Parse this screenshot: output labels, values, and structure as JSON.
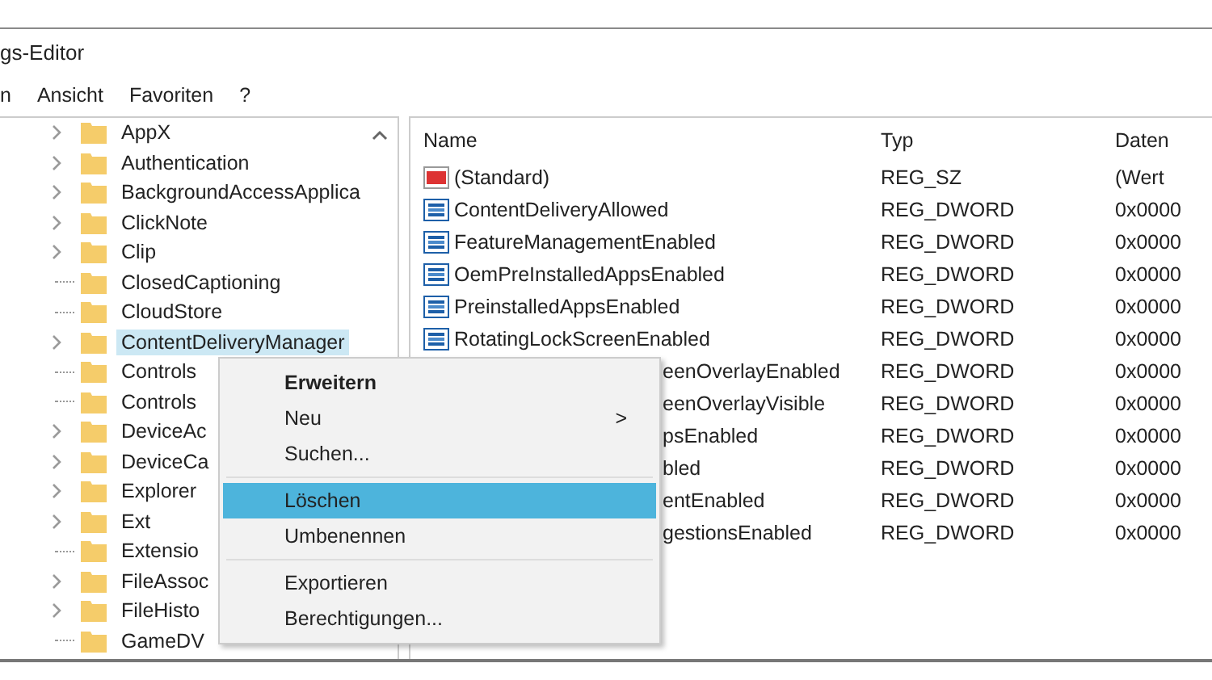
{
  "window": {
    "title": "gs-Editor"
  },
  "menu_bar": [
    "n",
    "Ansicht",
    "Favoriten",
    "?"
  ],
  "tree": [
    {
      "label": "AppX",
      "expandable": true,
      "selected": false
    },
    {
      "label": "Authentication",
      "expandable": true,
      "selected": false
    },
    {
      "label": "BackgroundAccessApplica",
      "expandable": true,
      "selected": false
    },
    {
      "label": "ClickNote",
      "expandable": true,
      "selected": false
    },
    {
      "label": "Clip",
      "expandable": true,
      "selected": false
    },
    {
      "label": "ClosedCaptioning",
      "expandable": false,
      "selected": false
    },
    {
      "label": "CloudStore",
      "expandable": false,
      "selected": false
    },
    {
      "label": "ContentDeliveryManager",
      "expandable": true,
      "selected": true
    },
    {
      "label": "Controls",
      "expandable": false,
      "selected": false
    },
    {
      "label": "Controls",
      "expandable": false,
      "selected": false
    },
    {
      "label": "DeviceAc",
      "expandable": true,
      "selected": false
    },
    {
      "label": "DeviceCa",
      "expandable": true,
      "selected": false
    },
    {
      "label": "Explorer",
      "expandable": true,
      "selected": false
    },
    {
      "label": "Ext",
      "expandable": true,
      "selected": false
    },
    {
      "label": "Extensio",
      "expandable": false,
      "selected": false
    },
    {
      "label": "FileAssoc",
      "expandable": true,
      "selected": false
    },
    {
      "label": "FileHisto",
      "expandable": true,
      "selected": false
    },
    {
      "label": "GameDV",
      "expandable": false,
      "selected": false
    }
  ],
  "table": {
    "columns": [
      "Name",
      "Typ",
      "Daten"
    ],
    "rows": [
      {
        "kind": "string",
        "name": "(Standard)",
        "type": "REG_SZ",
        "data": "(Wert"
      },
      {
        "kind": "binary",
        "name": "ContentDeliveryAllowed",
        "type": "REG_DWORD",
        "data": "0x0000"
      },
      {
        "kind": "binary",
        "name": "FeatureManagementEnabled",
        "type": "REG_DWORD",
        "data": "0x0000"
      },
      {
        "kind": "binary",
        "name": "OemPreInstalledAppsEnabled",
        "type": "REG_DWORD",
        "data": "0x0000"
      },
      {
        "kind": "binary",
        "name": "PreinstalledAppsEnabled",
        "type": "REG_DWORD",
        "data": "0x0000"
      },
      {
        "kind": "binary",
        "name": "RotatingLockScreenEnabled",
        "type": "REG_DWORD",
        "data": "0x0000"
      },
      {
        "kind": "covered",
        "name": "eenOverlayEnabled",
        "type": "REG_DWORD",
        "data": "0x0000"
      },
      {
        "kind": "covered",
        "name": "eenOverlayVisible",
        "type": "REG_DWORD",
        "data": "0x0000"
      },
      {
        "kind": "covered",
        "name": "psEnabled",
        "type": "REG_DWORD",
        "data": "0x0000"
      },
      {
        "kind": "covered",
        "name": "bled",
        "type": "REG_DWORD",
        "data": "0x0000"
      },
      {
        "kind": "covered",
        "name": "entEnabled",
        "type": "REG_DWORD",
        "data": "0x0000"
      },
      {
        "kind": "covered",
        "name": "gestionsEnabled",
        "type": "REG_DWORD",
        "data": "0x0000"
      }
    ]
  },
  "context_menu": [
    {
      "kind": "default",
      "label": "Erweitern",
      "selected": false
    },
    {
      "kind": "submenu",
      "label": "Neu",
      "arrow": ">",
      "selected": false
    },
    {
      "kind": "item",
      "label": "Suchen...",
      "selected": false
    },
    {
      "kind": "separator"
    },
    {
      "kind": "item",
      "label": "Löschen",
      "selected": true
    },
    {
      "kind": "item",
      "label": "Umbenennen",
      "selected": false
    },
    {
      "kind": "separator"
    },
    {
      "kind": "item",
      "label": "Exportieren",
      "selected": false
    },
    {
      "kind": "item",
      "label": "Berechtigungen...",
      "selected": false
    }
  ]
}
